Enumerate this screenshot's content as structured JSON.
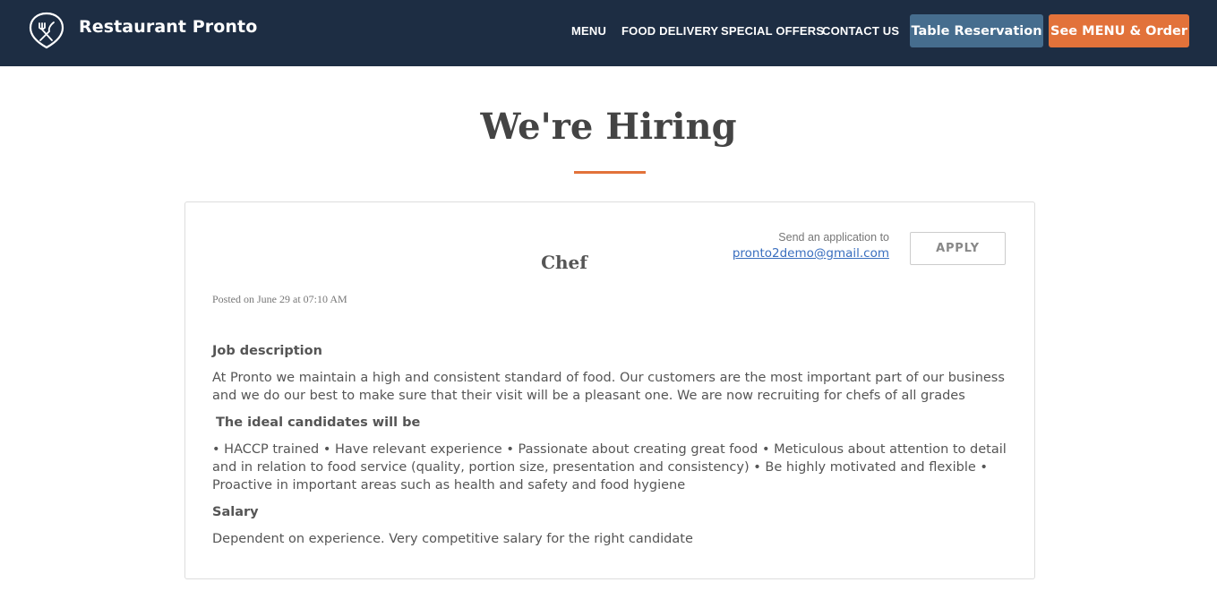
{
  "header": {
    "brand": "Restaurant Pronto",
    "logo_icon": "cutlery-shield-icon",
    "nav": [
      "MENU",
      "FOOD DELIVERY",
      "SPECIAL OFFERS",
      "CONTACT US"
    ],
    "reservation_label": "Table Reservation",
    "order_label": "See MENU & Order",
    "colors": {
      "bar": "#1d2d43",
      "reservation": "#466d8e",
      "order": "#e2723a"
    }
  },
  "page": {
    "title": "We're Hiring",
    "accent": "#e2723a"
  },
  "job": {
    "title": "Chef",
    "posted": "Posted on June 29 at 07:10 AM",
    "send_label": "Send an application to",
    "email": "pronto2demo@gmail.com",
    "apply_label": "APPLY",
    "description_heading": "Job description",
    "description": "At Pronto we maintain a high and consistent standard of food. Our customers are the most important part of our business and we do our best to make sure that their visit will be a pleasant one. We are now recruiting for chefs of all grades",
    "ideal_heading": "The ideal candidates will be",
    "ideal": "• HACCP trained • Have relevant experience  • Passionate about creating great food • Meticulous about attention to detail and in relation to food service (quality, portion size, presentation and consistency) • Be highly motivated and flexible • Proactive in important areas such as health and safety and food hygiene",
    "salary_heading": "Salary",
    "salary": "Dependent on experience. Very competitive salary for the right candidate"
  }
}
